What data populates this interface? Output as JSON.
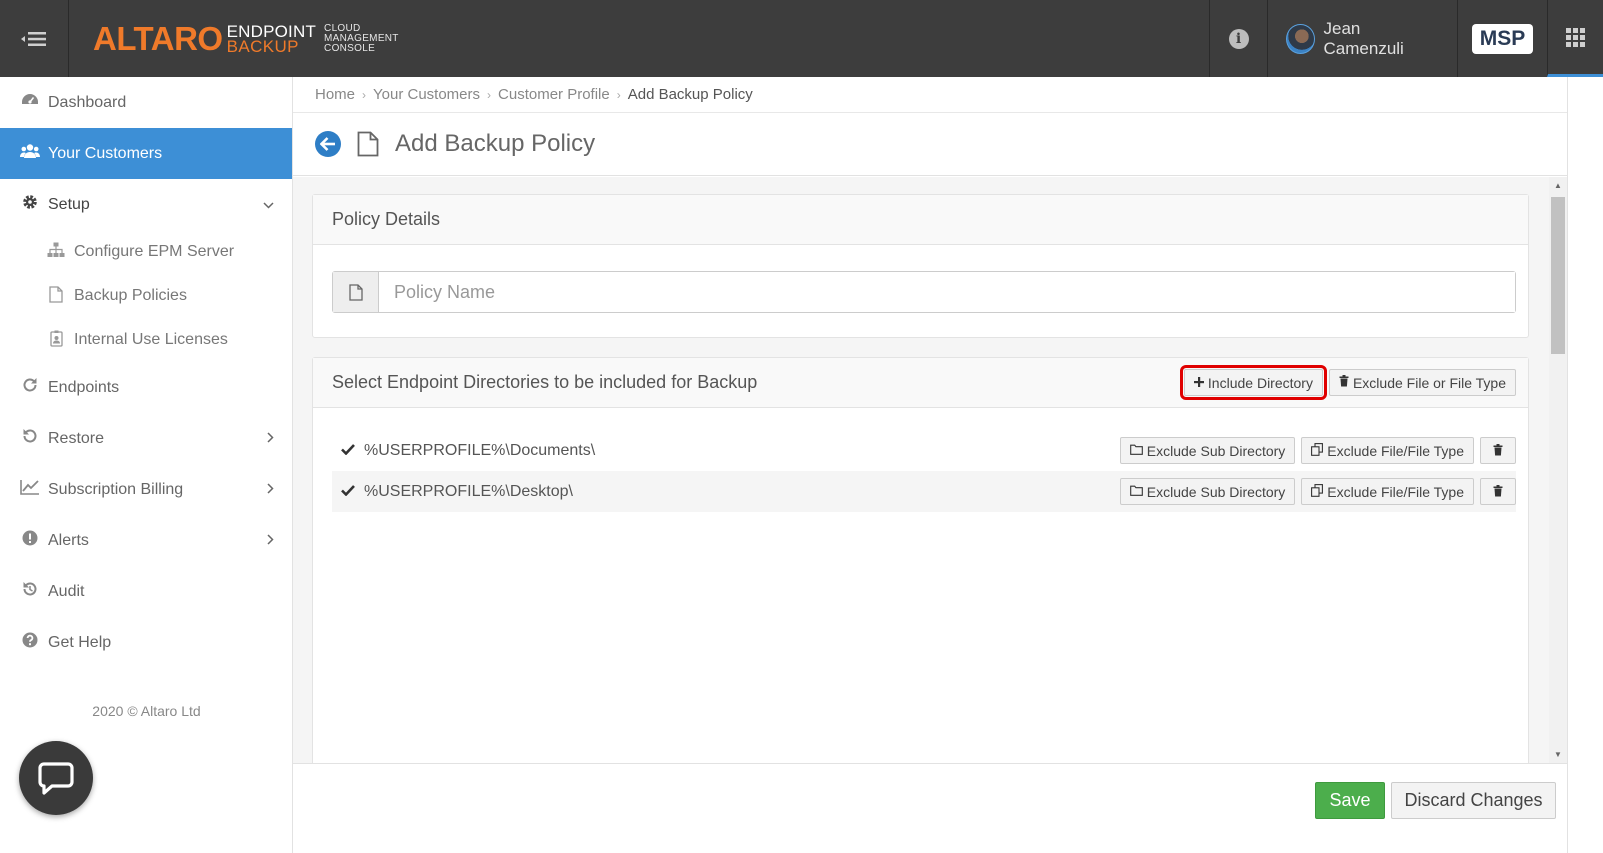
{
  "header": {
    "logo_brand": "ALTARO",
    "logo_product_line1": "ENDPOINT",
    "logo_product_line2": "BACKUP",
    "logo_console_line1": "CLOUD",
    "logo_console_line2": "MANAGEMENT",
    "logo_console_line3": "CONSOLE",
    "user_name": "Jean Camenzuli",
    "badge": "MSP"
  },
  "sidebar": {
    "items": [
      {
        "label": "Dashboard",
        "icon": "dashboard-icon"
      },
      {
        "label": "Your Customers",
        "icon": "users-icon"
      },
      {
        "label": "Setup",
        "icon": "gear-icon"
      },
      {
        "label": "Endpoints",
        "icon": "refresh-icon"
      },
      {
        "label": "Restore",
        "icon": "history-icon"
      },
      {
        "label": "Subscription Billing",
        "icon": "line-chart-icon"
      },
      {
        "label": "Alerts",
        "icon": "exclamation-icon"
      },
      {
        "label": "Audit",
        "icon": "history-icon"
      },
      {
        "label": "Get Help",
        "icon": "question-icon"
      }
    ],
    "setup_items": [
      {
        "label": "Configure EPM Server",
        "icon": "sitemap-icon"
      },
      {
        "label": "Backup Policies",
        "icon": "file-icon"
      },
      {
        "label": "Internal Use Licenses",
        "icon": "badge-icon"
      }
    ],
    "copyright": "2020  © Altaro Ltd"
  },
  "breadcrumb": [
    "Home",
    "Your Customers",
    "Customer Profile",
    "Add Backup Policy"
  ],
  "page": {
    "title": "Add Backup Policy"
  },
  "policy_details": {
    "heading": "Policy Details",
    "name_placeholder": "Policy Name",
    "name_value": ""
  },
  "directories": {
    "heading": "Select Endpoint Directories to be included for Backup",
    "include_button": "Include Directory",
    "exclude_button": "Exclude File or File Type",
    "rows": [
      {
        "path": "%USERPROFILE%\\Documents\\",
        "exclude_sub": "Exclude Sub Directory",
        "exclude_file": "Exclude File/File Type"
      },
      {
        "path": "%USERPROFILE%\\Desktop\\",
        "exclude_sub": "Exclude Sub Directory",
        "exclude_file": "Exclude File/File Type"
      }
    ]
  },
  "footer": {
    "save_label": "Save",
    "discard_label": "Discard Changes"
  },
  "colors": {
    "topbar": "#3d3d3d",
    "accent": "#3d8fd6",
    "brand_orange": "#f07a2a",
    "save_green": "#4cae4c",
    "highlight_red": "#e00000"
  }
}
